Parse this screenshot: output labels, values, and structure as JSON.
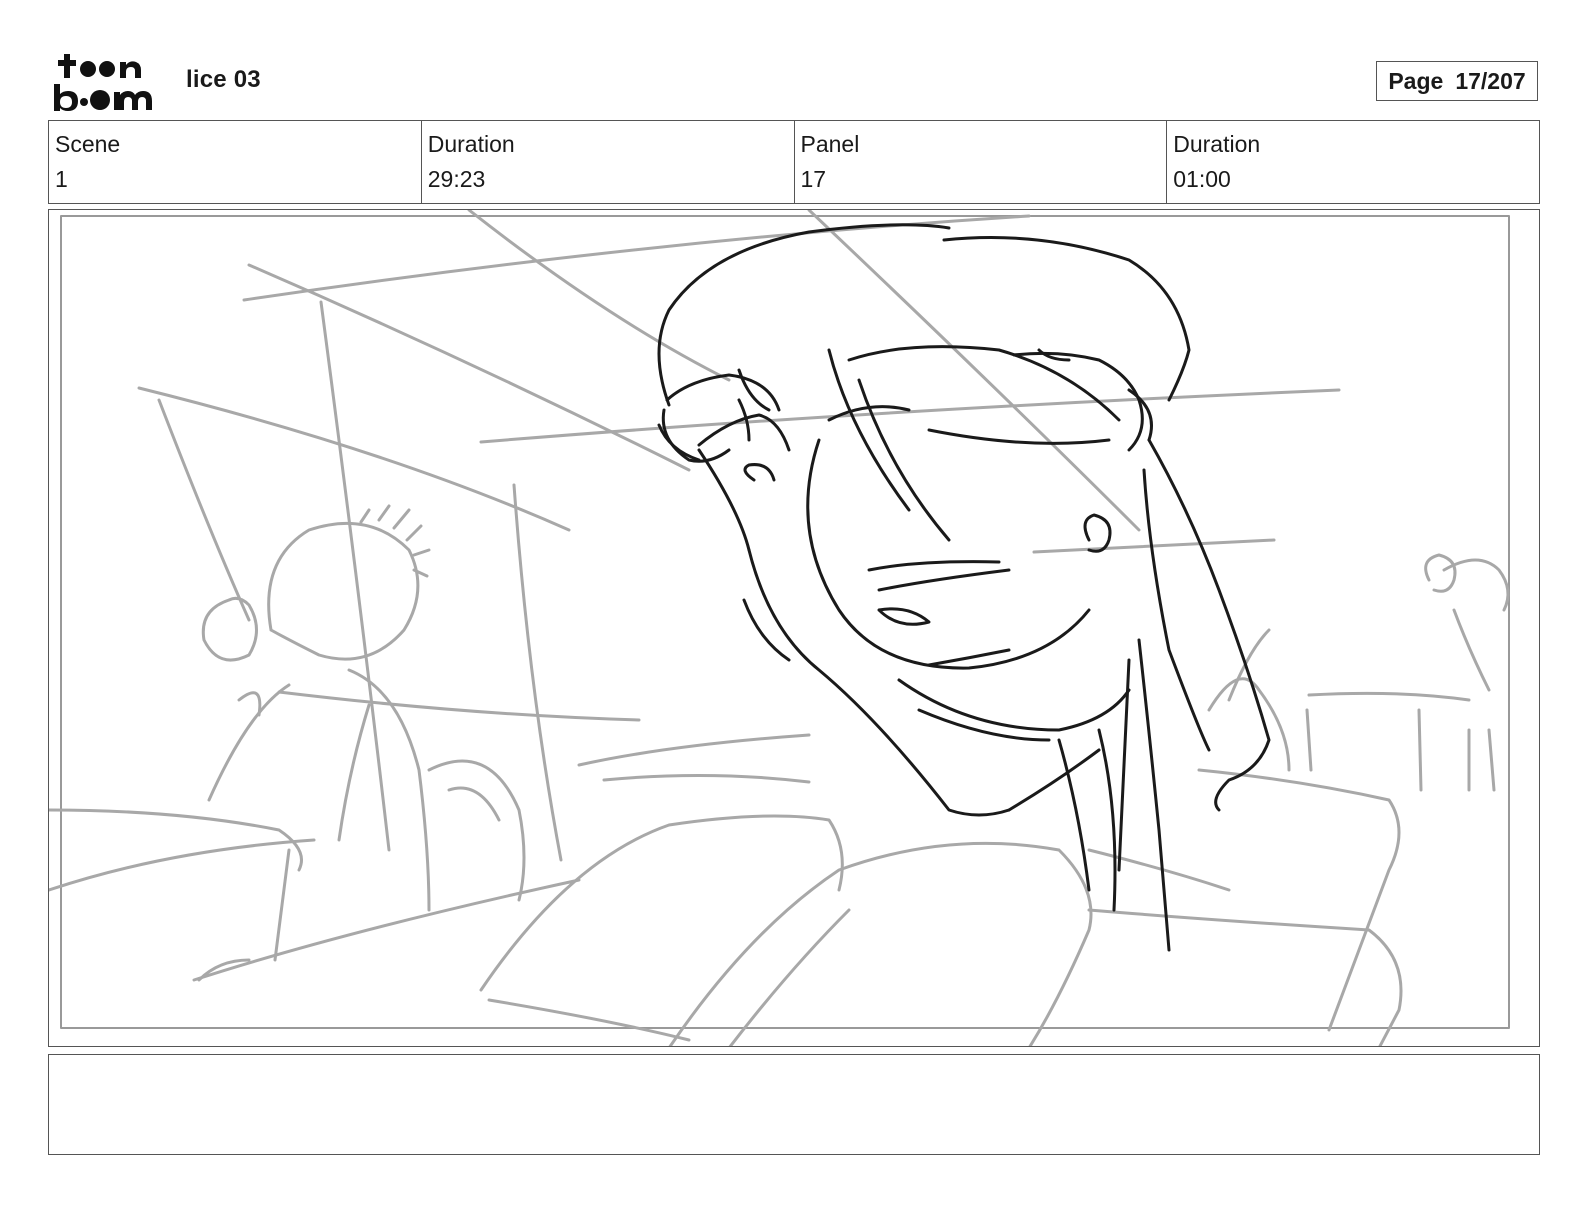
{
  "header": {
    "logo_text": "toon boom",
    "project_title": "lice 03",
    "page_label": "Page",
    "page_value": "17/207"
  },
  "info": {
    "scene_label": "Scene",
    "scene_value": "1",
    "scene_duration_label": "Duration",
    "scene_duration_value": "29:23",
    "panel_label": "Panel",
    "panel_value": "17",
    "panel_duration_label": "Duration",
    "panel_duration_value": "01:00"
  },
  "colors": {
    "sketch_dark": "#1a1a1a",
    "sketch_light": "#a8a8a8",
    "border": "#555555"
  }
}
